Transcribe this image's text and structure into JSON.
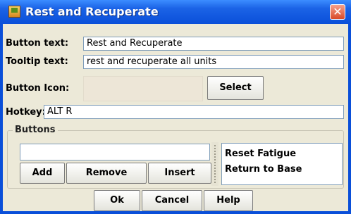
{
  "window": {
    "title": "Rest and Recuperate"
  },
  "form": {
    "button_text_label": "Button text:",
    "button_text_value": "Rest and Recuperate",
    "tooltip_label": "Tooltip text:",
    "tooltip_value": "rest and recuperate all units",
    "button_icon_label": "Button Icon:",
    "select_label": "Select",
    "hotkey_label": "Hotkey:",
    "hotkey_value": "ALT R"
  },
  "buttons_group": {
    "title": "Buttons",
    "new_value": "",
    "add_label": "Add",
    "remove_label": "Remove",
    "insert_label": "Insert",
    "items": [
      "Reset Fatigue",
      "Return to Base"
    ]
  },
  "footer": {
    "ok_label": "Ok",
    "cancel_label": "Cancel",
    "help_label": "Help"
  },
  "colors": {
    "titlebar": "#0a4fd9",
    "dialog_bg": "#ece9d8",
    "close_button": "#d94a28"
  },
  "icons": {
    "app": "java-cup-icon",
    "close": "close-icon"
  }
}
